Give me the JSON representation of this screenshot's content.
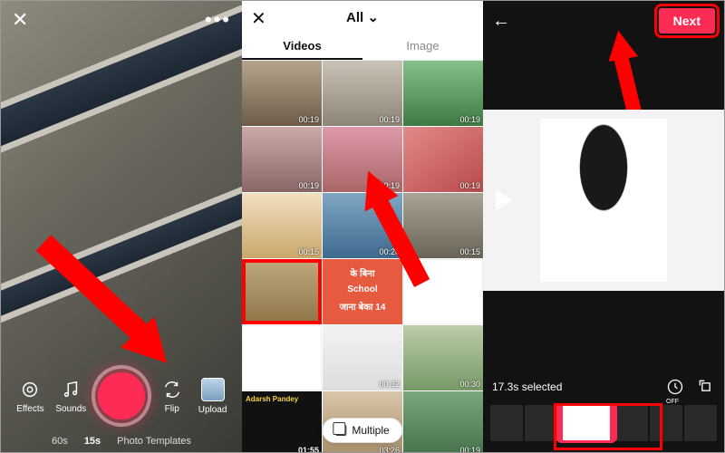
{
  "panel1": {
    "modes": {
      "m1": "60s",
      "m2": "15s",
      "m3": "Photo Templates"
    },
    "tools": {
      "effects": "Effects",
      "sounds": "Sounds",
      "flip": "Flip",
      "upload": "Upload"
    }
  },
  "panel2": {
    "title": "All",
    "tabs": {
      "videos": "Videos",
      "image": "Image"
    },
    "multiple": "Multiple",
    "overlay": {
      "l1": "के बिना",
      "l2": "School",
      "l3": "जाना बेका 14"
    },
    "adarsh": "Adarsh Pandey",
    "c": [
      {
        "d": "00:19"
      },
      {
        "d": "00:19"
      },
      {
        "d": "00:19"
      },
      {
        "d": "00:19"
      },
      {
        "d": "00:19"
      },
      {
        "d": "00:19"
      },
      {
        "d": "00:15"
      },
      {
        "d": "00:20"
      },
      {
        "d": "00:15"
      },
      {
        "d": ""
      },
      {
        "d": ""
      },
      {
        "d": ""
      },
      {
        "d": ""
      },
      {
        "d": "00:32"
      },
      {
        "d": "00:30"
      },
      {
        "d": ""
      },
      {
        "d": "01:55"
      },
      {
        "d": "03:26"
      },
      {
        "d": "00:19"
      }
    ]
  },
  "panel3": {
    "next": "Next",
    "selected": "17.3s selected",
    "speed_off": "OFF"
  }
}
